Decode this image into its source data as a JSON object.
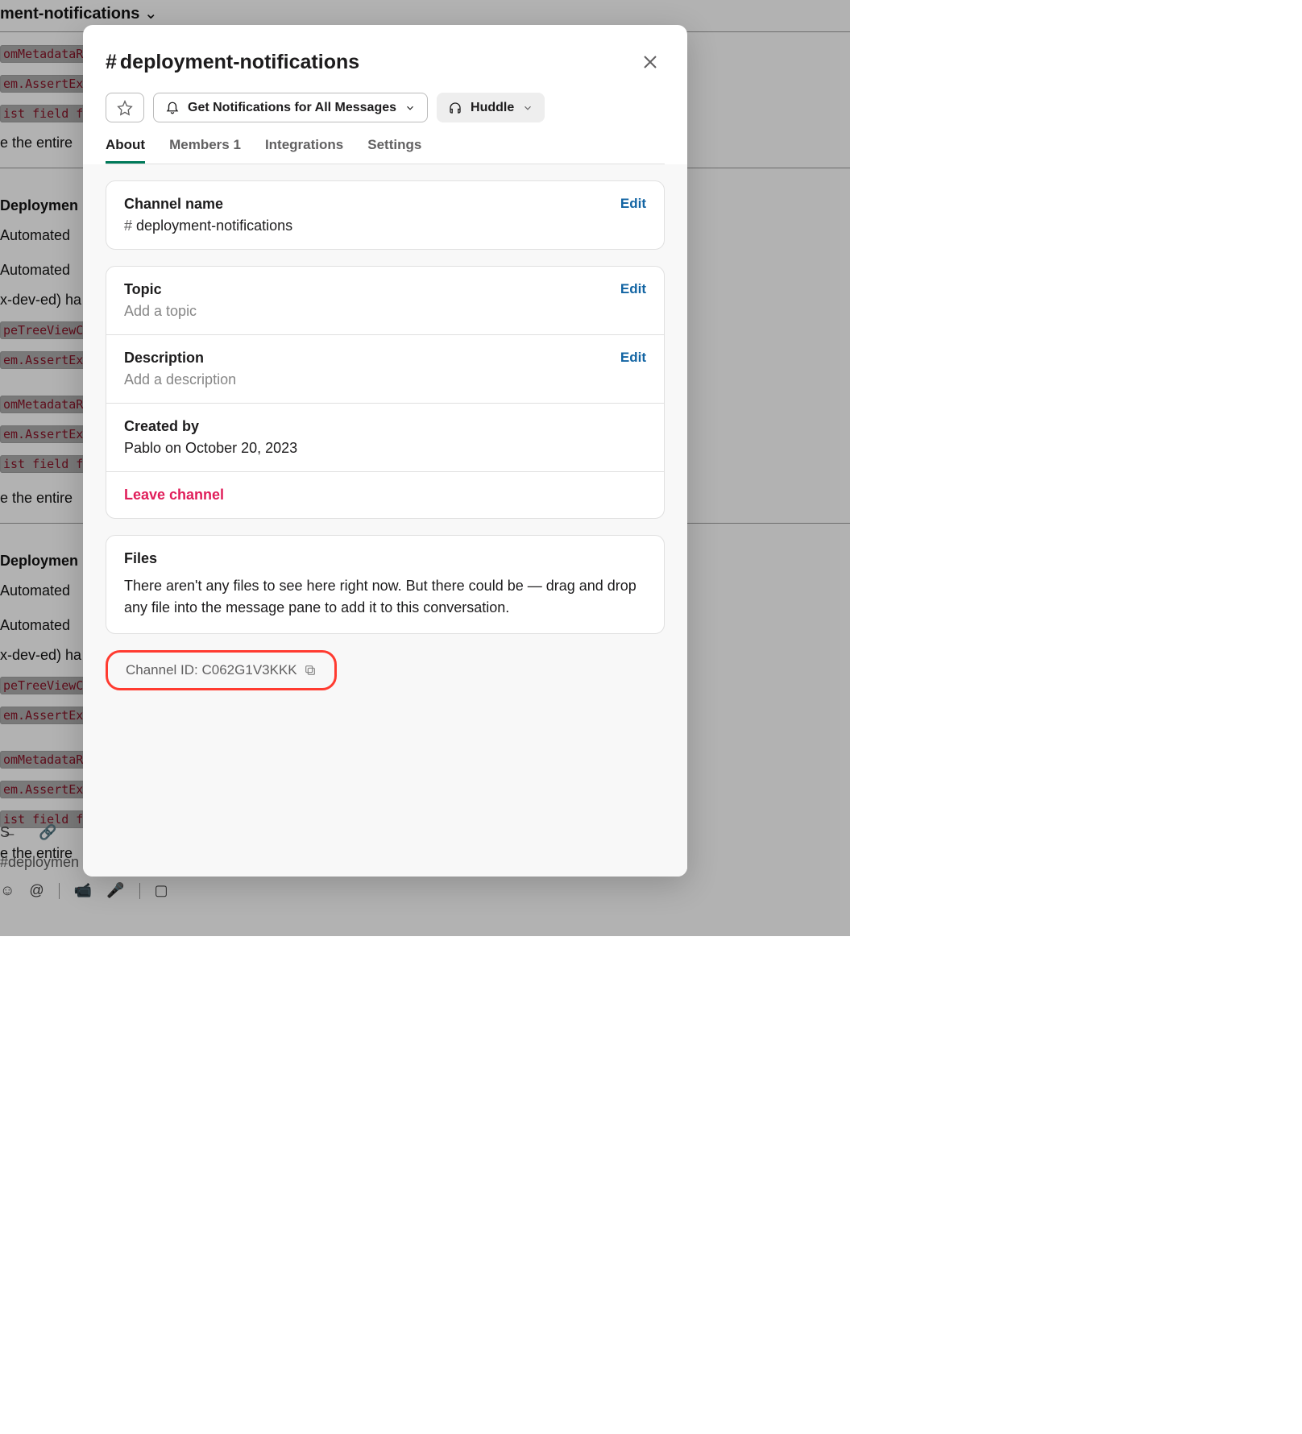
{
  "background": {
    "header": "ment-notifications",
    "code1": "omMetadataR",
    "code2": "em.AssertExc",
    "code3": "ist field f",
    "text_entire": "e the entire",
    "section_title": "Deploymen",
    "automated": "Automated ",
    "devtext": "x-dev-ed) ha",
    "code4": "peTreeViewC",
    "composer_placeholder": "#deploymen"
  },
  "modal": {
    "title": "deployment-notifications",
    "star_label": "Star",
    "notifications_label": "Get Notifications for All Messages",
    "huddle_label": "Huddle",
    "tabs": {
      "about": "About",
      "members": "Members",
      "members_count": "1",
      "integrations": "Integrations",
      "settings": "Settings"
    },
    "edit_label": "Edit",
    "channel_name": {
      "label": "Channel name",
      "value": "deployment-notifications"
    },
    "topic": {
      "label": "Topic",
      "placeholder": "Add a topic"
    },
    "description": {
      "label": "Description",
      "placeholder": "Add a description"
    },
    "created_by": {
      "label": "Created by",
      "value": "Pablo on October 20, 2023"
    },
    "leave_label": "Leave channel",
    "files": {
      "label": "Files",
      "text": "There aren't any files to see here right now. But there could be — drag and drop any file into the message pane to add it to this conversation."
    },
    "channel_id": {
      "label": "Channel ID: ",
      "value": "C062G1V3KKK"
    }
  }
}
